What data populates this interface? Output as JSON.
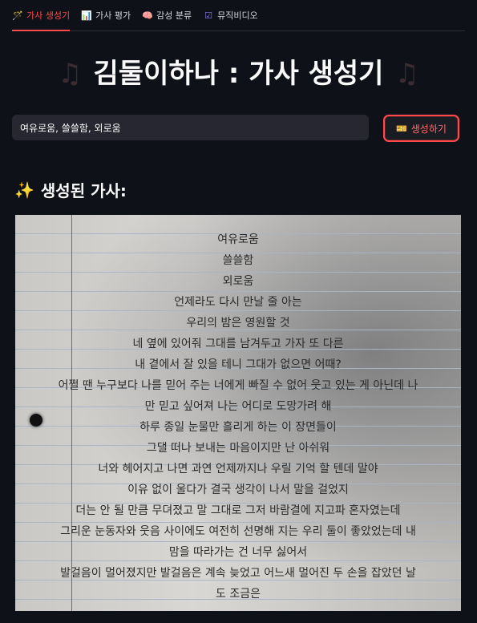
{
  "tabs": [
    {
      "icon": "🪄",
      "label": "가사 생성기",
      "active": true
    },
    {
      "icon": "📊",
      "label": "가사 평가",
      "active": false
    },
    {
      "icon": "🧠",
      "label": "감성 분류",
      "active": false
    },
    {
      "icon": "☑",
      "label": "뮤직비디오",
      "active": false
    }
  ],
  "header": {
    "title": "김둘이하나 : 가사 생성기",
    "note_left": "♫",
    "note_right": "♫"
  },
  "input": {
    "value": "여유로움, 쓸쓸함, 외로움"
  },
  "generate_button": {
    "icon": "🎫",
    "label": "생성하기"
  },
  "result": {
    "icon": "✨",
    "heading": "생성된 가사:"
  },
  "lyrics": [
    "여유로움",
    "쓸쓸함",
    "외로움",
    "언제라도 다시 만날 줄 아는",
    "우리의 밤은 영원할 것",
    "네 옆에 있어줘 그대를 남겨두고 가자 또 다른",
    "내 곁에서 잘 있을 테니 그대가 없으면 어때?",
    "어쩔 땐 누구보다 나를 믿어 주는 너에게 빠질 수 없어 웃고 있는 게 아닌데 나",
    "만 믿고 싶어져 나는 어디로 도망가려 해",
    "하루 종일 눈물만 흘리게 하는 이 장면들이",
    "그댈 떠나 보내는 마음이지만 난 아쉬워",
    "너와 헤어지고 나면 과연 언제까지나 우릴 기억 할 텐데 말야",
    "이유 없이 울다가 결국 생각이 나서 말을 걸었지",
    "더는 안 될 만큼 무뎌졌고 말 그대로 그저 바람결에 지고파 혼자였는데",
    "그리운 눈동자와 웃음 사이에도 여전히 선명해 지는 우리 둘이 좋았었는데 내",
    "맘을 따라가는 건 너무 싫어서",
    "발걸음이 멀어졌지만 발걸음은 계속 늦었고 어느새 멀어진 두 손을 잡았던 날",
    "도 조금은"
  ]
}
